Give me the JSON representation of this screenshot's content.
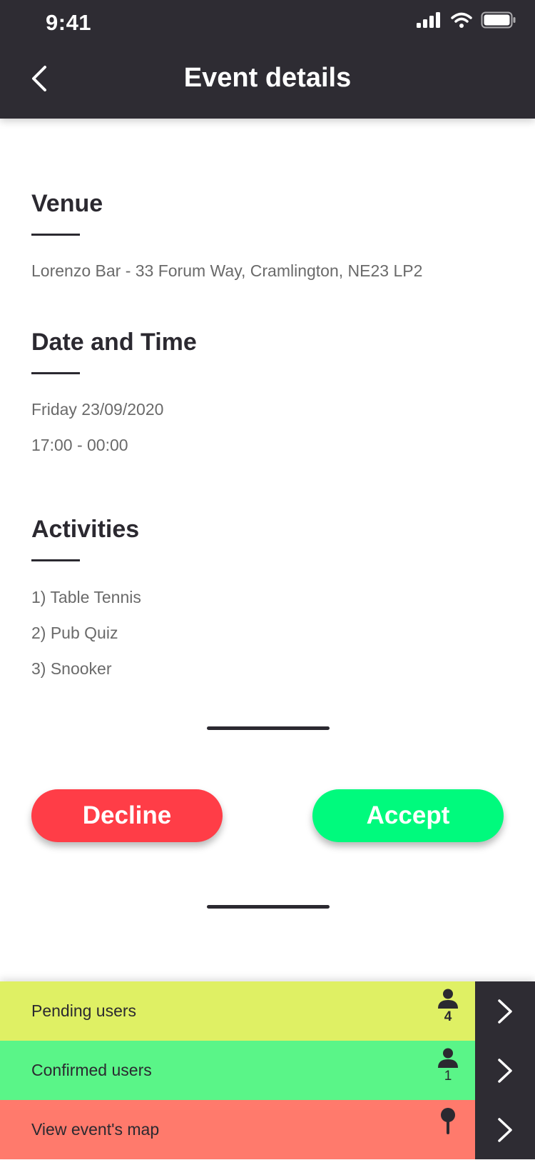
{
  "status_bar": {
    "time": "9:41"
  },
  "header": {
    "title": "Event details",
    "back_icon": "chevron-left-icon"
  },
  "venue": {
    "title": "Venue",
    "text": "Lorenzo Bar - 33 Forum Way, Cramlington, NE23 LP2"
  },
  "date_time": {
    "title": "Date and Time",
    "date": "Friday 23/09/2020",
    "time": "17:00 - 00:00"
  },
  "activities": {
    "title": "Activities",
    "items": [
      "1) Table Tennis",
      "2) Pub Quiz",
      "3) Snooker"
    ]
  },
  "actions": {
    "decline_label": "Decline",
    "accept_label": "Accept",
    "decline_color": "#ff3d47",
    "accept_color": "#00fa7d"
  },
  "bottom_rows": {
    "pending": {
      "label": "Pending users",
      "count": "4",
      "icon": "person-icon",
      "color": "#dff064"
    },
    "confirmed": {
      "label": "Confirmed users",
      "count": "1",
      "icon": "person-icon",
      "color": "#5af588"
    },
    "map": {
      "label": "View event's map",
      "icon": "map-pin-icon",
      "color": "#ff7a6c"
    }
  }
}
